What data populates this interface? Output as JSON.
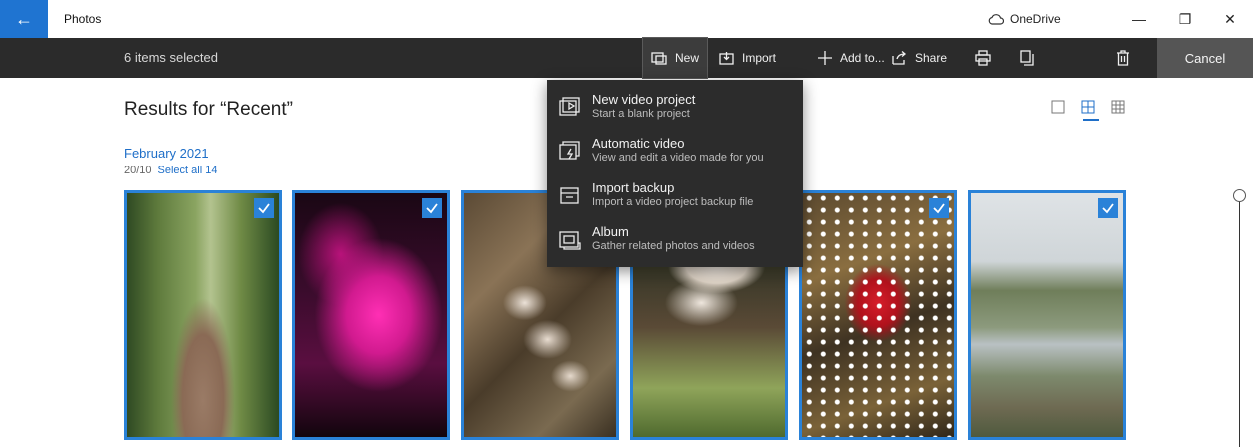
{
  "titlebar": {
    "app_title": "Photos",
    "back_icon": "back-arrow-icon",
    "onedrive_label": "OneDrive",
    "minimize": "—",
    "maximize": "❐",
    "close": "✕"
  },
  "commandbar": {
    "selection_text": "6 items selected",
    "new_label": "New",
    "import_label": "Import",
    "add_to_label": "Add to...",
    "share_label": "Share",
    "cancel_label": "Cancel"
  },
  "content": {
    "results_title": "Results for “Recent”",
    "month": "February 2021",
    "sub_count": "20/10",
    "sub_select_all": "Select all 14"
  },
  "menu": {
    "items": [
      {
        "title": "New video project",
        "subtitle": "Start a blank project",
        "icon": "video-project-icon"
      },
      {
        "title": "Automatic video",
        "subtitle": "View and edit a video made for you",
        "icon": "auto-video-icon"
      },
      {
        "title": "Import backup",
        "subtitle": "Import a video project backup file",
        "icon": "import-backup-icon"
      },
      {
        "title": "Album",
        "subtitle": "Gather related photos and videos",
        "icon": "album-icon"
      }
    ]
  },
  "photos": [
    {
      "name": "woodland-path",
      "selected": true
    },
    {
      "name": "pink-lit-trees",
      "selected": true
    },
    {
      "name": "mushrooms-on-log",
      "selected": false
    },
    {
      "name": "white-mushrooms-closeup",
      "selected": false
    },
    {
      "name": "fly-agaric",
      "selected": true
    },
    {
      "name": "river-scene",
      "selected": true
    }
  ],
  "colors": {
    "accent": "#1f74d1",
    "command_bar": "#2b2b2b",
    "menu_bg": "#2c2c2c",
    "cancel_bg": "#555555",
    "link": "#1f6fc8"
  }
}
